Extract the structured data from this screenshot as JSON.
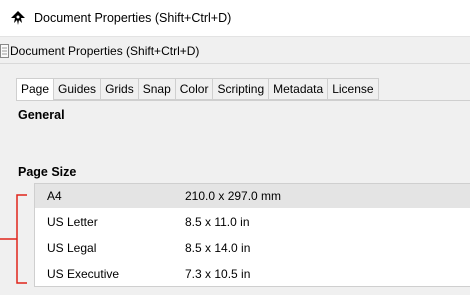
{
  "window": {
    "title": "Document Properties (Shift+Ctrl+D)",
    "icon": "inkscape-app-icon"
  },
  "toolbar": {
    "title": "Document Properties (Shift+Ctrl+D)",
    "icon": "document-icon"
  },
  "tabs": [
    {
      "label": "Page",
      "active": true
    },
    {
      "label": "Guides",
      "active": false
    },
    {
      "label": "Grids",
      "active": false
    },
    {
      "label": "Snap",
      "active": false
    },
    {
      "label": "Color",
      "active": false
    },
    {
      "label": "Scripting",
      "active": false
    },
    {
      "label": "Metadata",
      "active": false
    },
    {
      "label": "License",
      "active": false
    }
  ],
  "sections": {
    "general": "General",
    "page_size": "Page Size"
  },
  "page_sizes": [
    {
      "name": "A4",
      "dims": "210.0 x 297.0 mm",
      "selected": true
    },
    {
      "name": "US Letter",
      "dims": "8.5 x 11.0 in",
      "selected": false
    },
    {
      "name": "US Legal",
      "dims": "8.5 x 14.0 in",
      "selected": false
    },
    {
      "name": "US Executive",
      "dims": "7.3 x 10.5 in",
      "selected": false
    }
  ],
  "colors": {
    "annotation_bracket": "#e0241b",
    "selected_row": "#e4e4e4",
    "panel_bg": "#f0f0f0"
  }
}
